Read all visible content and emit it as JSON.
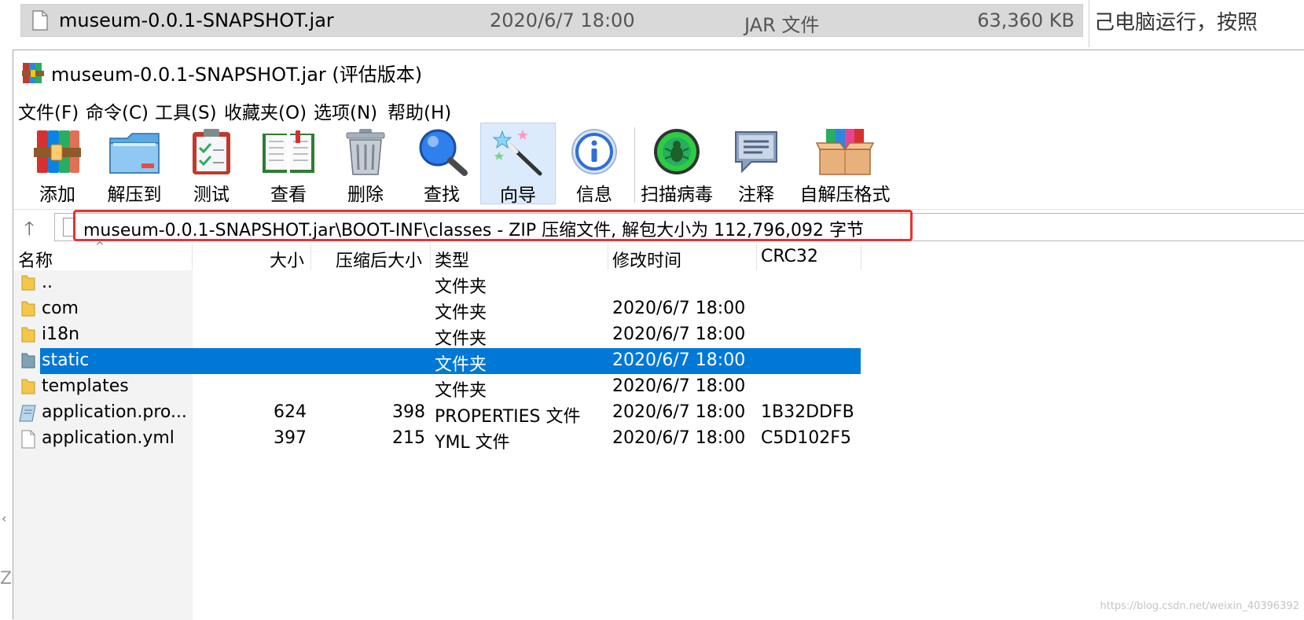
{
  "background_file": {
    "name": "museum-0.0.1-SNAPSHOT.jar",
    "date": "2020/6/7 18:00",
    "type": "JAR 文件",
    "size": "63,360 KB"
  },
  "background_article_text": "己电脑运行，按照",
  "window": {
    "title": "museum-0.0.1-SNAPSHOT.jar (评估版本)"
  },
  "menu": [
    {
      "label": "文件(F)"
    },
    {
      "label": "命令(C)"
    },
    {
      "label": "工具(S)"
    },
    {
      "label": "收藏夹(O)"
    },
    {
      "label": "选项(N)"
    },
    {
      "label": "帮助(H)"
    }
  ],
  "toolbar": [
    {
      "label": "添加",
      "icon": "add-books-icon"
    },
    {
      "label": "解压到",
      "icon": "extract-folder-icon"
    },
    {
      "label": "测试",
      "icon": "test-clipboard-icon"
    },
    {
      "label": "查看",
      "icon": "view-book-icon"
    },
    {
      "label": "删除",
      "icon": "trash-icon"
    },
    {
      "label": "查找",
      "icon": "magnifier-icon"
    },
    {
      "label": "向导",
      "icon": "wizard-wand-icon"
    },
    {
      "label": "信息",
      "icon": "info-icon"
    },
    {
      "label": "扫描病毒",
      "icon": "virus-scan-icon"
    },
    {
      "label": "注释",
      "icon": "comment-icon"
    },
    {
      "label": "自解压格式",
      "icon": "sfx-box-icon"
    }
  ],
  "address": {
    "path": "museum-0.0.1-SNAPSHOT.jar\\BOOT-INF\\classes - ZIP 压缩文件, 解包大小为 112,796,092 字节"
  },
  "columns": {
    "name": "名称",
    "size": "大小",
    "packed": "压缩后大小",
    "type": "类型",
    "modified": "修改时间",
    "crc": "CRC32"
  },
  "files": [
    {
      "name": "..",
      "size": "",
      "packed": "",
      "type": "文件夹",
      "modified": "",
      "crc": ""
    },
    {
      "name": "com",
      "size": "",
      "packed": "",
      "type": "文件夹",
      "modified": "2020/6/7 18:00",
      "crc": ""
    },
    {
      "name": "i18n",
      "size": "",
      "packed": "",
      "type": "文件夹",
      "modified": "2020/6/7 18:00",
      "crc": ""
    },
    {
      "name": "static",
      "size": "",
      "packed": "",
      "type": "文件夹",
      "modified": "2020/6/7 18:00",
      "crc": ""
    },
    {
      "name": "templates",
      "size": "",
      "packed": "",
      "type": "文件夹",
      "modified": "2020/6/7 18:00",
      "crc": ""
    },
    {
      "name": "application.pro...",
      "size": "624",
      "packed": "398",
      "type": "PROPERTIES 文件",
      "modified": "2020/6/7 18:00",
      "crc": "1B32DDFB"
    },
    {
      "name": "application.yml",
      "size": "397",
      "packed": "215",
      "type": "YML 文件",
      "modified": "2020/6/7 18:00",
      "crc": "C5D102F5"
    }
  ],
  "watermark": "https://blog.csdn.net/weixin_40396392",
  "colors": {
    "selection": "#0078d7",
    "highlight_box": "#e53333",
    "folder": "#f3c74a"
  }
}
